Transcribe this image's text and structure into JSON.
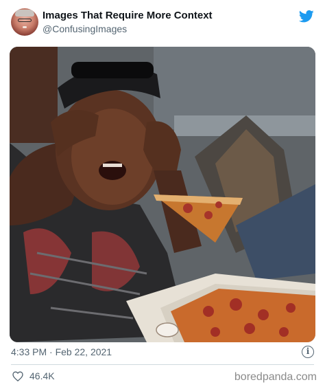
{
  "author": {
    "name": "Images That Require More Context",
    "handle": "@ConfusingImages"
  },
  "icons": {
    "twitter": "twitter-bird-icon",
    "info": "info-icon",
    "like": "heart-icon",
    "info_glyph": "i"
  },
  "colors": {
    "twitter_blue": "#1d9bf0",
    "secondary_text": "#536471"
  },
  "tweet": {
    "timestamp": "4:33 PM · Feb 22, 2021",
    "likes": "46.4K"
  },
  "watermark": "boredpanda.com"
}
